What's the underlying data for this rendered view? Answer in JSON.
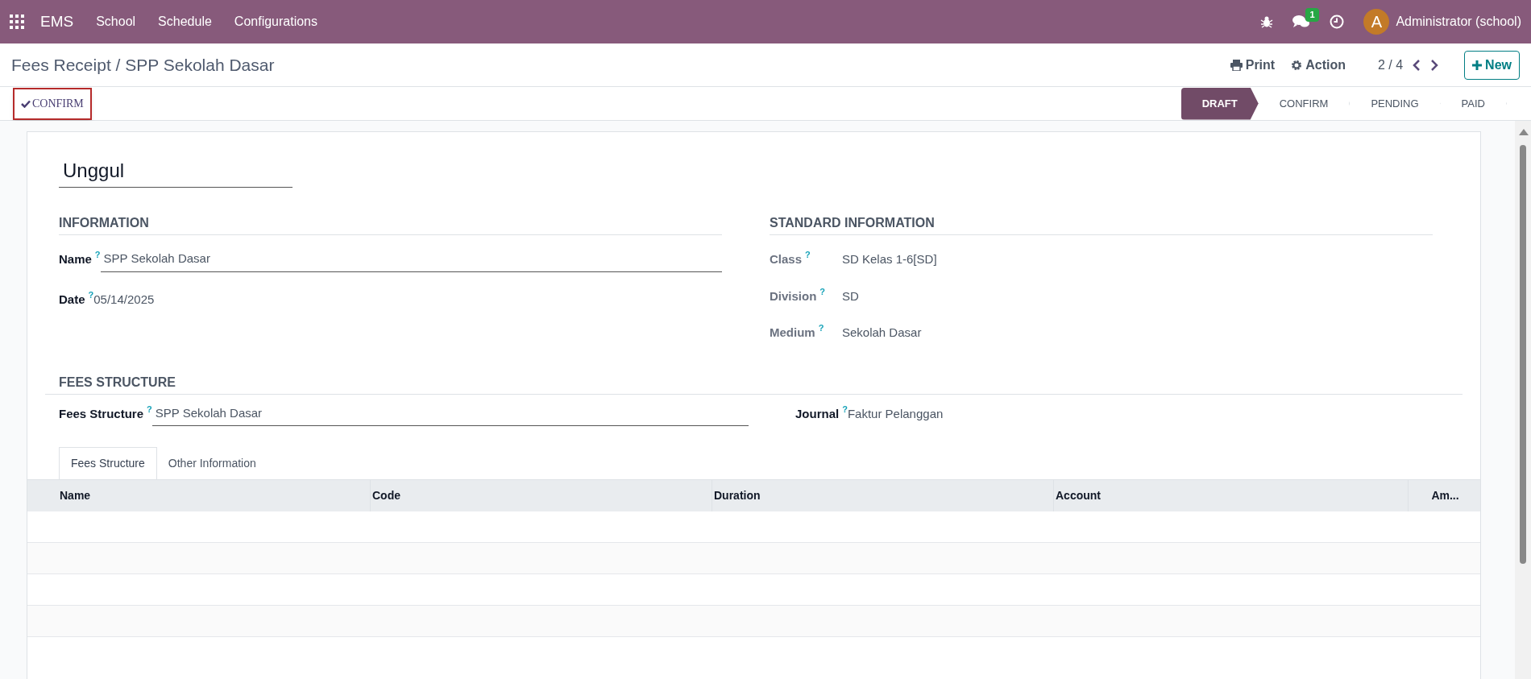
{
  "navbar": {
    "brand": "EMS",
    "menu": [
      "School",
      "Schedule",
      "Configurations"
    ],
    "messages_badge": "1",
    "avatar_letter": "A",
    "user": "Administrator (school)"
  },
  "control_panel": {
    "breadcrumb": "Fees Receipt / SPP Sekolah Dasar",
    "print": "Print",
    "action": "Action",
    "pager": "2 / 4",
    "new_button": "New"
  },
  "status_bar": {
    "button": "CONFIRM",
    "stages": [
      {
        "label": "DRAFT",
        "selected": true
      },
      {
        "label": "CONFIRM",
        "selected": false
      },
      {
        "label": "PENDING",
        "selected": false
      },
      {
        "label": "PAID",
        "selected": false
      }
    ]
  },
  "form": {
    "title": "Unggul",
    "information": {
      "heading": "INFORMATION",
      "fields": [
        {
          "label": "Name",
          "help": "?",
          "value": "SPP Sekolah Dasar",
          "kind": "input"
        },
        {
          "label": "Date",
          "help": "?",
          "value": "05/14/2025",
          "kind": "text"
        }
      ]
    },
    "standard_information": {
      "heading": "STANDARD INFORMATION",
      "fields": [
        {
          "label": "Class",
          "help": "?",
          "value": "SD Kelas 1-6[SD]",
          "kind": "text"
        },
        {
          "label": "Division",
          "help": "?",
          "value": "SD",
          "kind": "text"
        },
        {
          "label": "Medium",
          "help": "?",
          "value": "Sekolah Dasar",
          "kind": "text"
        }
      ]
    },
    "fees_structure": {
      "heading": "FEES STRUCTURE",
      "left": {
        "label": "Fees Structure",
        "help": "?",
        "value": "SPP Sekolah Dasar",
        "kind": "input"
      },
      "right": {
        "label": "Journal",
        "help": "?",
        "value": "Faktur Pelanggan",
        "kind": "text"
      }
    },
    "tabs": [
      {
        "label": "Fees Structure",
        "selected": true
      },
      {
        "label": "Other Information",
        "selected": false
      }
    ],
    "table": {
      "columns": [
        "Name",
        "Code",
        "Duration",
        "Account",
        "Am..."
      ]
    }
  }
}
